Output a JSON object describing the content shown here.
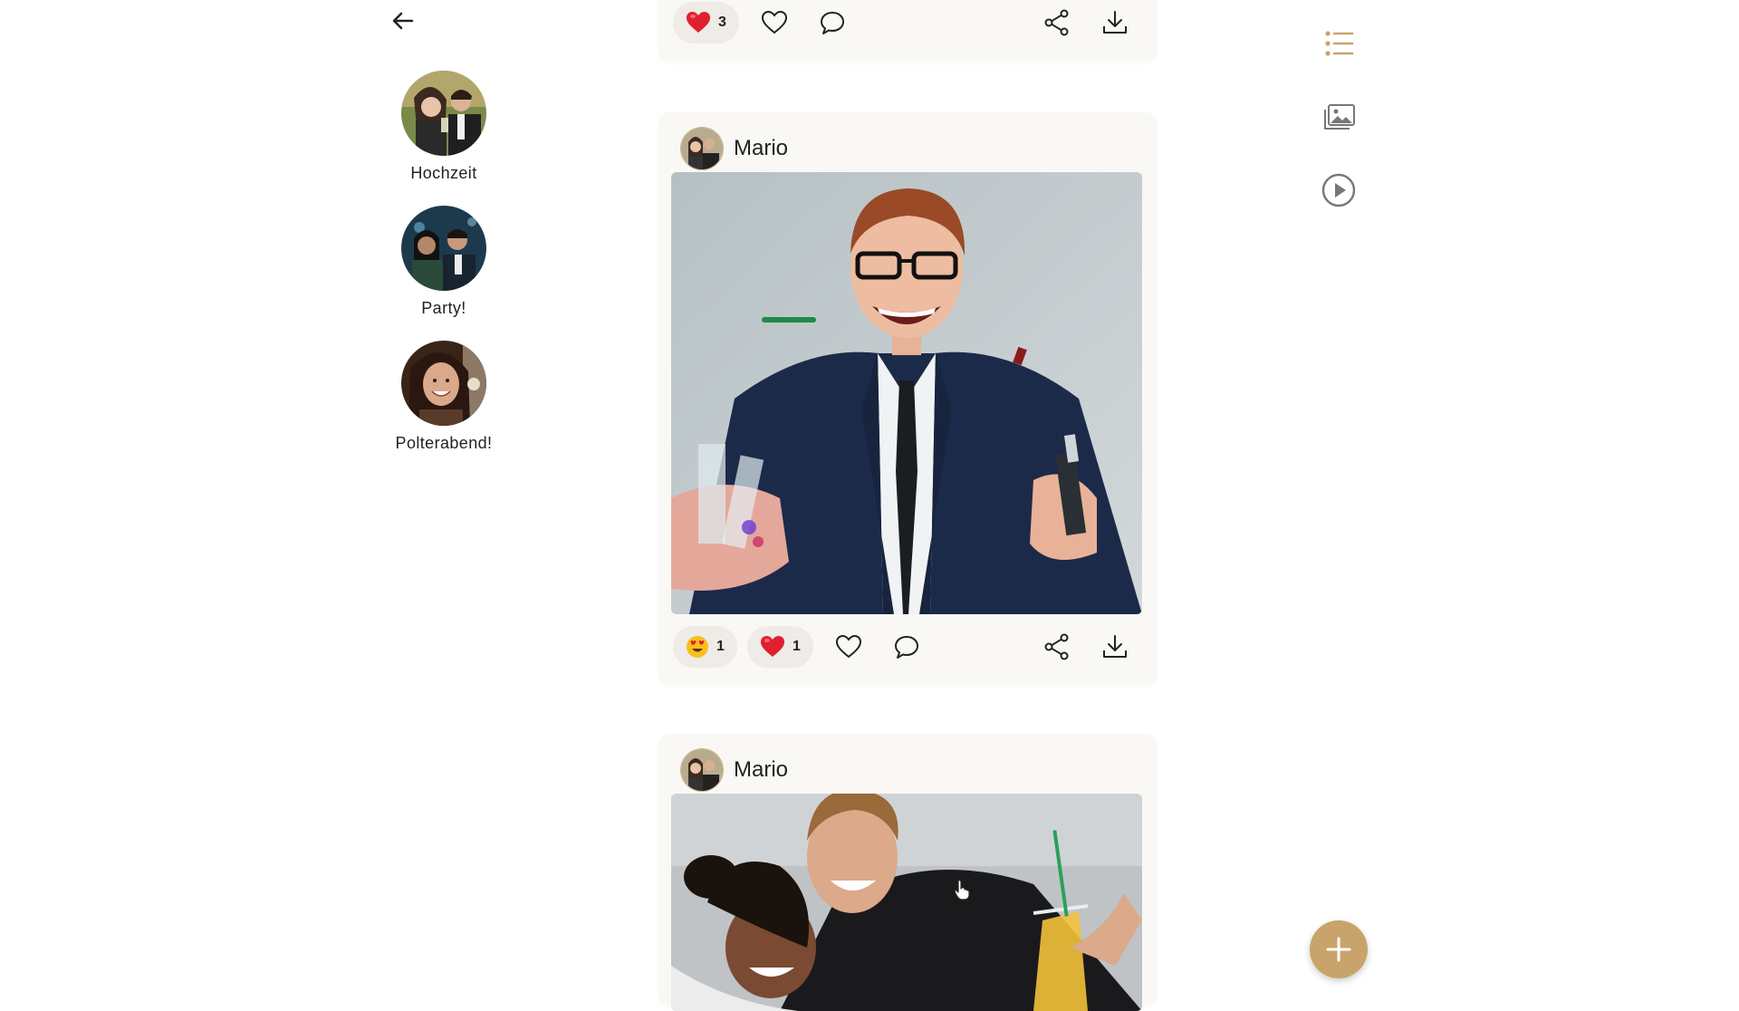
{
  "albums": [
    {
      "name": "Hochzeit"
    },
    {
      "name": "Party!"
    },
    {
      "name": "Polterabend!"
    }
  ],
  "posts": [
    {
      "reactions": [
        {
          "emoji": "heart",
          "count": "3"
        }
      ]
    },
    {
      "author": "Mario",
      "reactions": [
        {
          "emoji": "heart-eyes",
          "count": "1"
        },
        {
          "emoji": "heart",
          "count": "1"
        }
      ]
    },
    {
      "author": "Mario"
    }
  ],
  "sidebar_icons": [
    "list-icon",
    "gallery-icon",
    "play-icon"
  ],
  "colors": {
    "accent": "#c8a46a",
    "heart": "#e0202f",
    "card": "#faf8f5"
  }
}
